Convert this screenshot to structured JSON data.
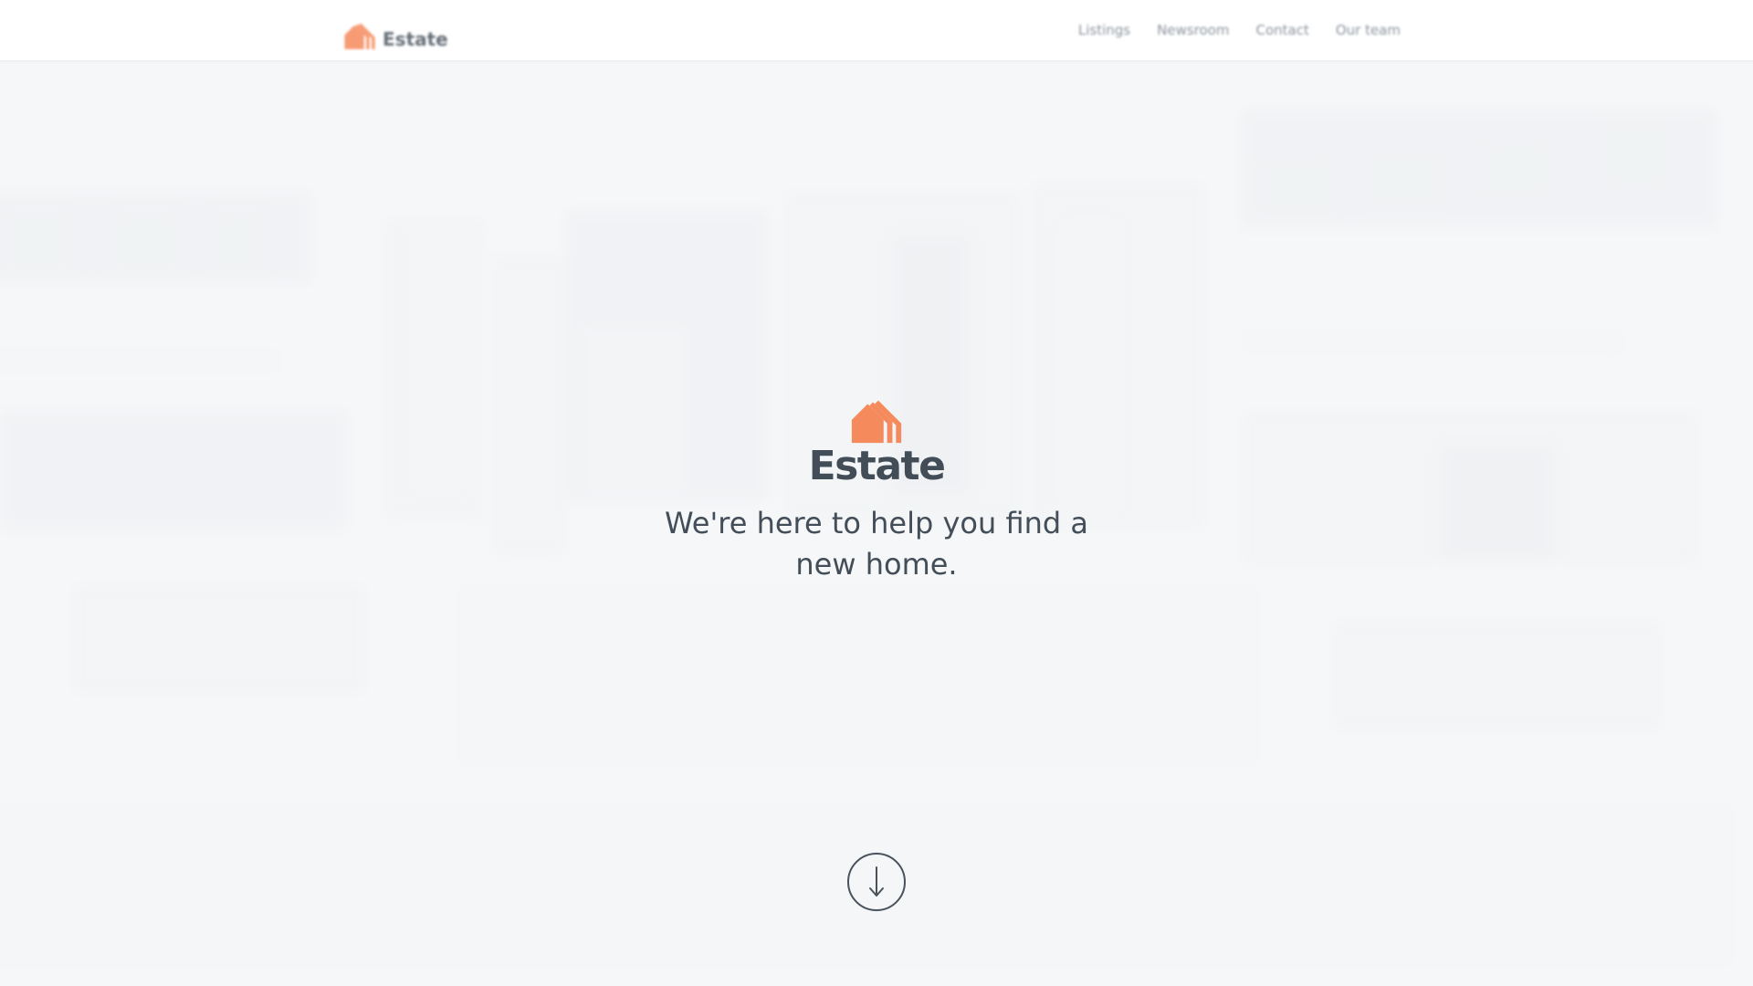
{
  "nav": {
    "brand_name": "Estate",
    "links": [
      {
        "label": "Listings"
      },
      {
        "label": "Newsroom"
      },
      {
        "label": "Contact"
      },
      {
        "label": "Our team"
      }
    ]
  },
  "hero": {
    "brand_name": "Estate",
    "tagline": "We're here to help you find a new home.",
    "scroll_icon": "arrow-down-circle-icon"
  },
  "colors": {
    "accent": "#f58a5c",
    "heading": "#424d58",
    "nav_text": "#8b939c",
    "background": "#f4f5f7"
  }
}
